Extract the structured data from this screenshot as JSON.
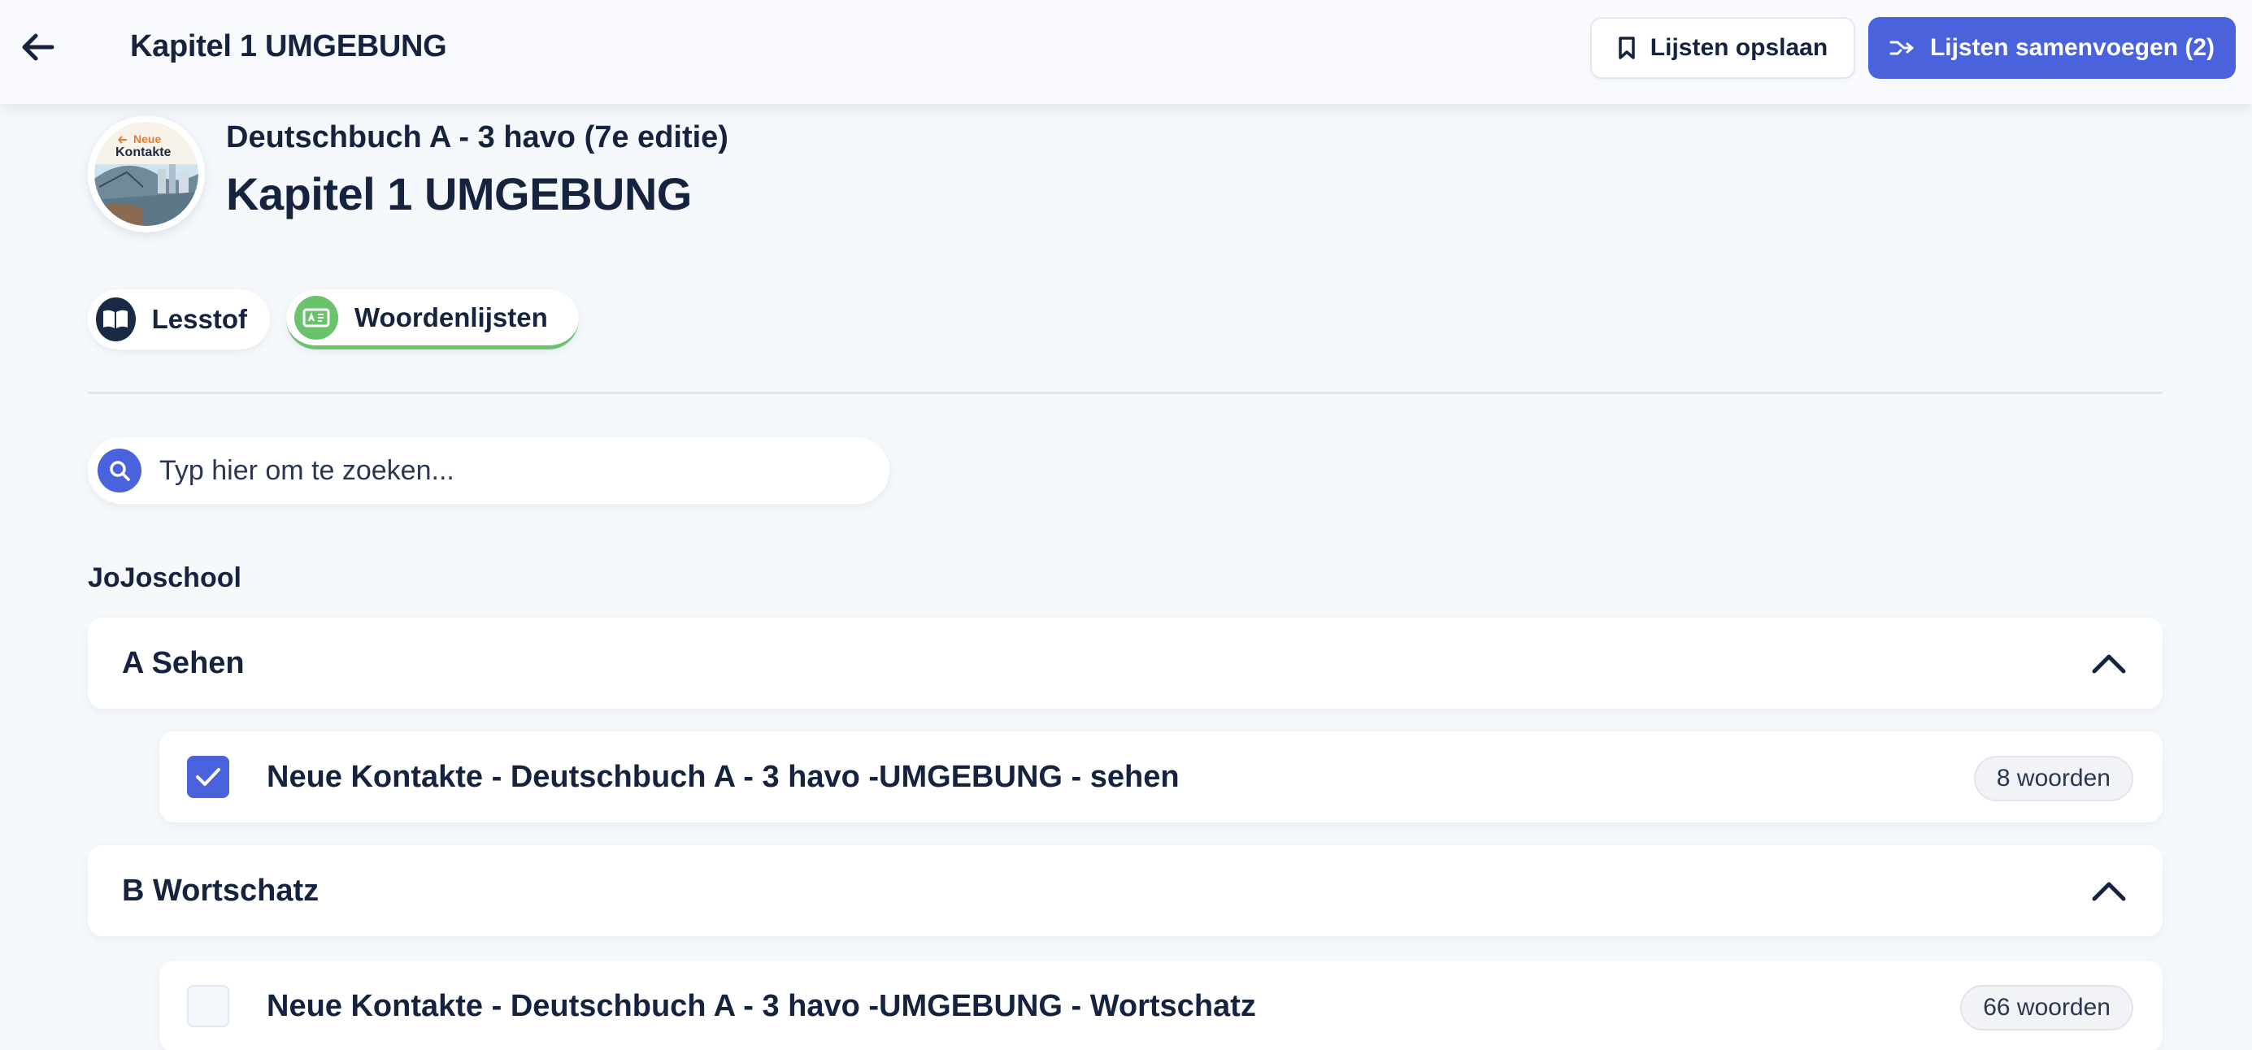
{
  "header": {
    "title": "Kapitel 1 UMGEBUNG",
    "save_label": "Lijsten opslaan",
    "merge_label": "Lijsten samenvoegen (2)"
  },
  "book": {
    "subtitle": "Deutschbuch A - 3 havo (7e editie)",
    "title": "Kapitel 1 UMGEBUNG",
    "cover_text_line1": "Neue",
    "cover_text_line2": "Kontakte"
  },
  "tabs": [
    {
      "label": "Lesstof",
      "active": false
    },
    {
      "label": "Woordenlijsten",
      "active": true
    }
  ],
  "search": {
    "placeholder": "Typ hier om te zoeken..."
  },
  "section": {
    "label": "JoJoschool"
  },
  "groups": [
    {
      "title": "A Sehen",
      "expanded": true,
      "items": [
        {
          "title": "Neue Kontakte - Deutschbuch A - 3 havo -UMGEBUNG - sehen",
          "count": "8 woorden",
          "checked": true
        }
      ]
    },
    {
      "title": "B Wortschatz",
      "expanded": true,
      "items": [
        {
          "title": "Neue Kontakte - Deutschbuch A - 3 havo -UMGEBUNG - Wortschatz",
          "count": "66 woorden",
          "checked": false
        }
      ]
    }
  ],
  "colors": {
    "primary": "#4a63dc",
    "text": "#15233f",
    "background": "#f6f9fc",
    "active_tab_accent": "#6ac26d"
  },
  "icons": {
    "back": "arrow-left-icon",
    "save": "bookmark-icon",
    "merge": "merge-arrow-icon",
    "lesstof": "book-icon",
    "woorden": "flashcard-icon",
    "search": "search-icon",
    "chevron": "chevron-up-icon",
    "check": "check-icon"
  }
}
